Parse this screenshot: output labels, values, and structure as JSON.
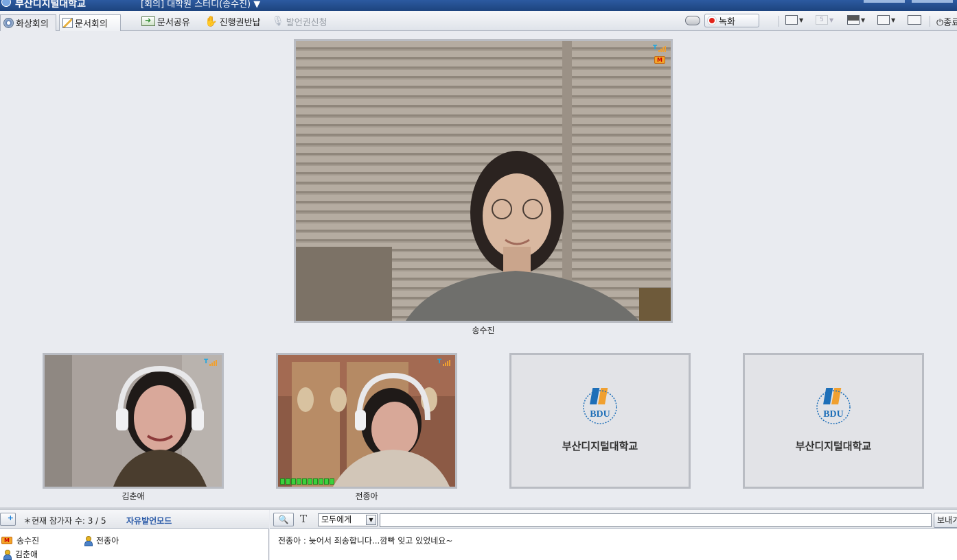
{
  "titlebar": {
    "app_title": "부산디지털대학교",
    "room_title": "[회의] 대학원 스터디(송수진)",
    "dropdown_icon": "chevron-down-icon"
  },
  "toolbar": {
    "tabs": [
      {
        "label": "화상회의",
        "icon": "webcam-icon",
        "active": true
      },
      {
        "label": "문서회의",
        "icon": "pencil-doc-icon",
        "active": false
      }
    ],
    "share_doc": "문서공유",
    "return_control": "진행권반납",
    "request_speak": "발언권신청",
    "record": "녹화",
    "exit": "종료",
    "layout_number": "5"
  },
  "videos": {
    "main": {
      "name": "송수진"
    },
    "small": [
      {
        "name": "김춘애"
      },
      {
        "name": "전종아"
      }
    ],
    "placeholders": [
      {
        "logo_text": "BDU",
        "school": "부산디지털대학교"
      },
      {
        "logo_text": "BDU",
        "school": "부산디지털대학교"
      }
    ],
    "master_badge": "M",
    "signal_badge": "T"
  },
  "participants": {
    "count_label": "＊현재 참가자 수: 3 / 5",
    "mode_label": "자유발언모드",
    "list": [
      {
        "name": "송수진",
        "role": "master"
      },
      {
        "name": "전종아",
        "role": "member"
      },
      {
        "name": "김춘애",
        "role": "member"
      }
    ]
  },
  "chat": {
    "target": "모두에게",
    "input_value": "",
    "send_label": "보내기",
    "messages": [
      {
        "text": "전종아 : 늦어서 죄송합니다...깜빡 잊고 있었네요~"
      }
    ]
  },
  "colors": {
    "titlebar": "#1d447f",
    "accent": "#2a5aa8",
    "record_dot": "#e2231a",
    "logo_blue": "#1e6fb8",
    "logo_orange": "#f0a030"
  }
}
